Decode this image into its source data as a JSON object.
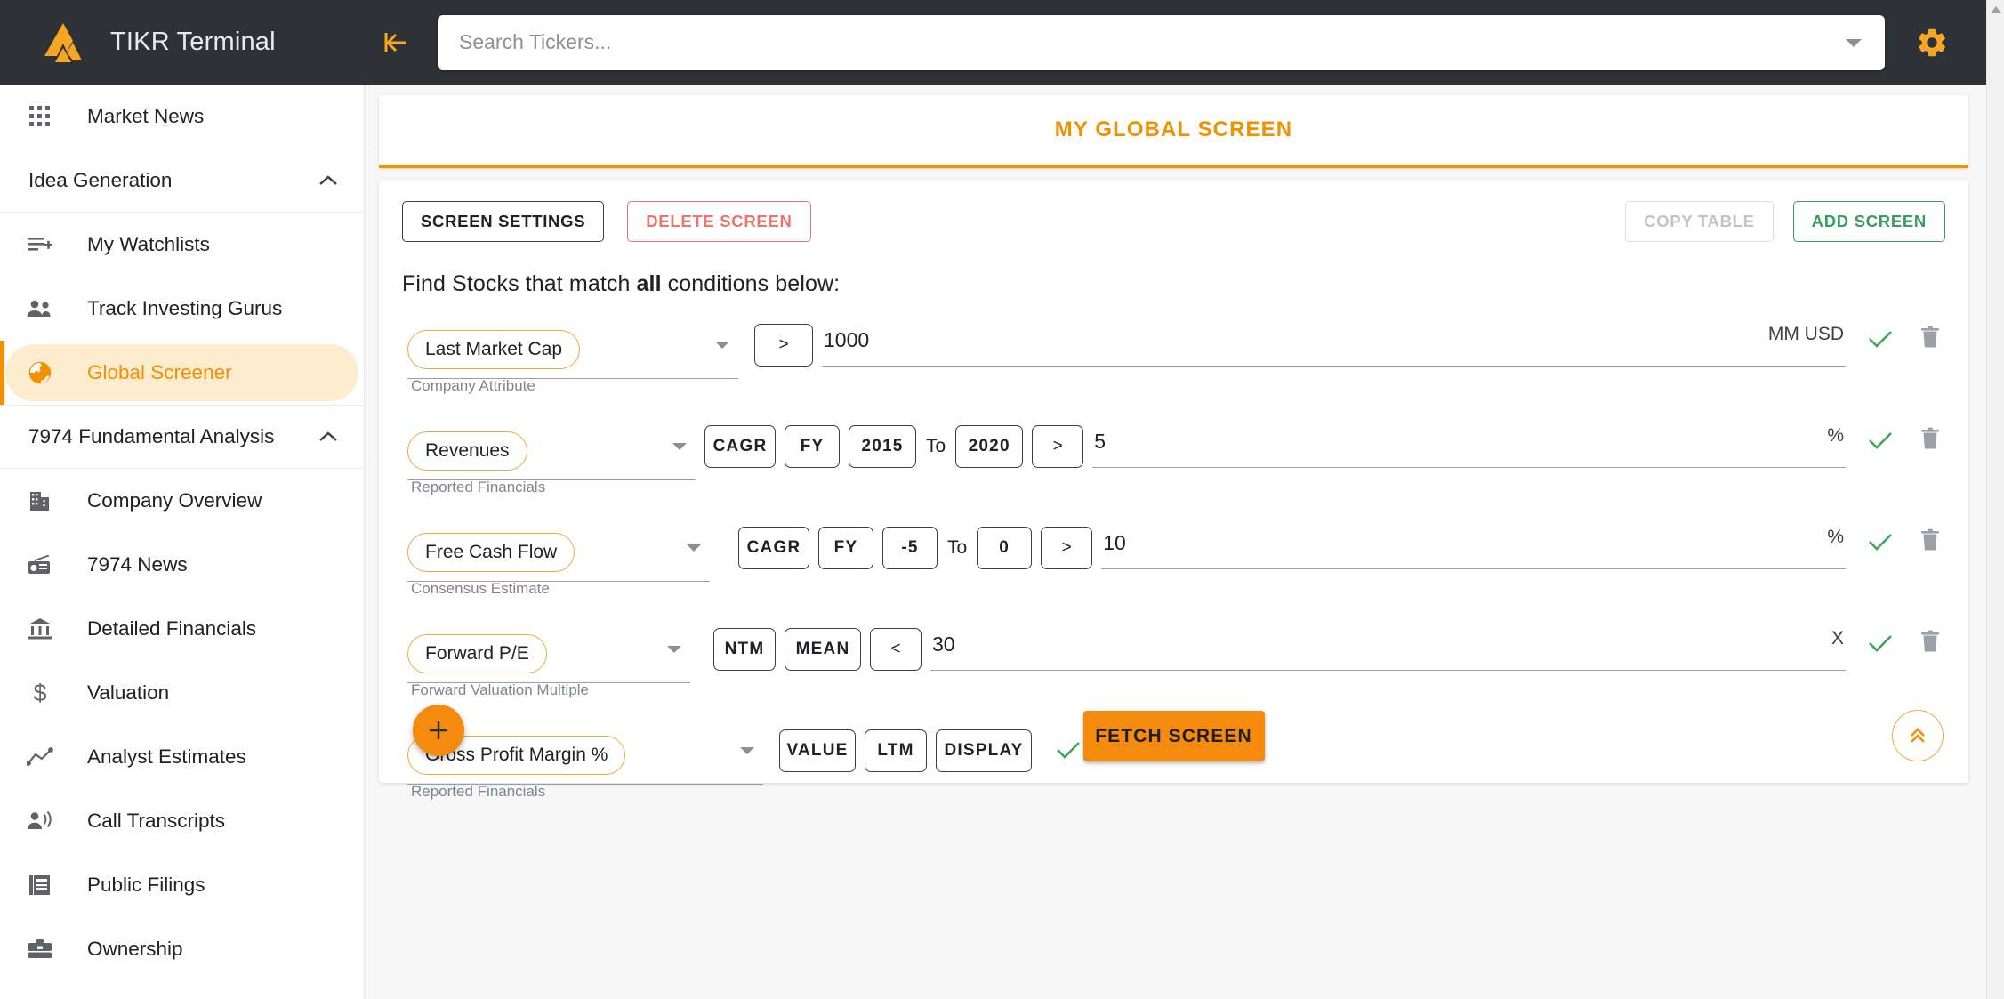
{
  "app": {
    "brand_title": "TIKR Terminal",
    "logo_icon": "tikr-triangle-logo",
    "collapse_icon": "collapse-left-icon",
    "gear_icon": "gear-icon"
  },
  "search": {
    "placeholder": "Search Tickers...",
    "value": "",
    "caret_icon": "chevron-down-icon"
  },
  "sidebar": {
    "items": [
      {
        "label": "Market News",
        "icon": "grid-apps-icon",
        "type": "item",
        "active": false
      },
      {
        "label": "Idea Generation",
        "icon": "chevron-up-icon",
        "type": "section"
      },
      {
        "label": "My Watchlists",
        "icon": "playlist-add-icon",
        "type": "item",
        "active": false
      },
      {
        "label": "Track Investing Gurus",
        "icon": "people-icon",
        "type": "item",
        "active": false
      },
      {
        "label": "Global Screener",
        "icon": "globe-icon",
        "type": "item",
        "active": true
      },
      {
        "label": "7974 Fundamental Analysis",
        "icon": "chevron-up-icon",
        "type": "section"
      },
      {
        "label": "Company Overview",
        "icon": "building-icon",
        "type": "item",
        "active": false
      },
      {
        "label": "7974 News",
        "icon": "radio-icon",
        "type": "item",
        "active": false
      },
      {
        "label": "Detailed Financials",
        "icon": "bank-icon",
        "type": "item",
        "active": false
      },
      {
        "label": "Valuation",
        "icon": "dollar-icon",
        "type": "item",
        "active": false
      },
      {
        "label": "Analyst Estimates",
        "icon": "line-chart-icon",
        "type": "item",
        "active": false
      },
      {
        "label": "Call Transcripts",
        "icon": "person-speaking-icon",
        "type": "item",
        "active": false
      },
      {
        "label": "Public Filings",
        "icon": "documents-icon",
        "type": "item",
        "active": false
      },
      {
        "label": "Ownership",
        "icon": "briefcase-icon",
        "type": "item",
        "active": false
      }
    ]
  },
  "main": {
    "screen_title": "MY GLOBAL SCREEN",
    "toolbar": {
      "screen_settings": "SCREEN SETTINGS",
      "delete_screen": "DELETE SCREEN",
      "copy_table": "COPY TABLE",
      "add_screen": "ADD SCREEN"
    },
    "find_prefix": "Find Stocks that match ",
    "find_bold": "all",
    "find_suffix": " conditions below:",
    "filters": [
      {
        "metric": "Last Market Cap",
        "category": "Company Attribute",
        "ops": [],
        "comparator": ">",
        "value": "1000",
        "unit": "MM USD",
        "has_range": false,
        "to_word": "",
        "check_icon": "check-icon",
        "delete_icon": "trash-icon"
      },
      {
        "metric": "Revenues",
        "category": "Reported Financials",
        "ops": [
          "CAGR",
          "FY",
          "2015"
        ],
        "to_word": "To",
        "range_end": "2020",
        "comparator": ">",
        "value": "5",
        "unit": "%",
        "has_range": true,
        "check_icon": "check-icon",
        "delete_icon": "trash-icon"
      },
      {
        "metric": "Free Cash Flow",
        "category": "Consensus Estimate",
        "ops": [
          "CAGR",
          "FY",
          "-5"
        ],
        "to_word": "To",
        "range_end": "0",
        "comparator": ">",
        "value": "10",
        "unit": "%",
        "has_range": true,
        "check_icon": "check-icon",
        "delete_icon": "trash-icon"
      },
      {
        "metric": "Forward P/E",
        "category": "Forward Valuation Multiple",
        "ops": [
          "NTM",
          "MEAN"
        ],
        "to_word": "",
        "range_end": "",
        "comparator": "<",
        "value": "30",
        "unit": "X",
        "has_range": false,
        "check_icon": "check-icon",
        "delete_icon": "trash-icon"
      },
      {
        "metric": "Gross Profit Margin %",
        "category": "Reported Financials",
        "ops": [
          "VALUE",
          "LTM",
          "DISPLAY"
        ],
        "to_word": "",
        "range_end": "",
        "comparator": "",
        "value": "",
        "unit": "",
        "has_range": false,
        "display_only": true,
        "check_icon": "check-icon",
        "delete_icon": "trash-icon"
      }
    ],
    "add_filter_label": "+",
    "fetch_label": "FETCH SCREEN",
    "scroll_top_icon": "double-chevron-up-icon"
  },
  "colors": {
    "accent_orange": "#f29100",
    "brand_dark": "#2e3136",
    "green": "#3aa757",
    "red": "#e8776f"
  }
}
